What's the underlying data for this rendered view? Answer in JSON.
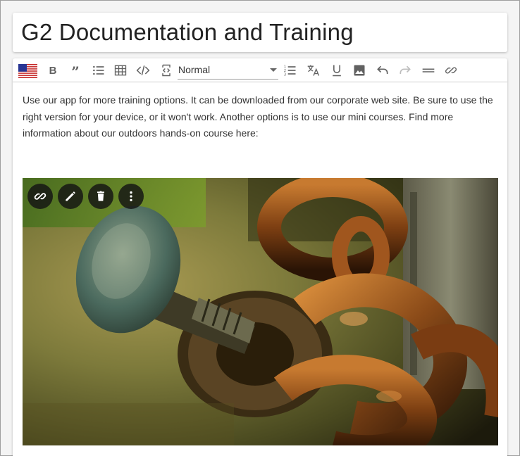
{
  "page": {
    "title": "G2 Documentation and Training"
  },
  "toolbar": {
    "language_icon": "us-flag-icon",
    "format_select": {
      "selected": "Normal"
    },
    "buttons": [
      {
        "name": "bold-button",
        "icon": "bold-icon"
      },
      {
        "name": "blockquote-button",
        "icon": "quote-icon"
      },
      {
        "name": "bulleted-list-button",
        "icon": "bulleted-list-icon"
      },
      {
        "name": "table-button",
        "icon": "table-icon"
      },
      {
        "name": "code-button",
        "icon": "code-icon"
      },
      {
        "name": "source-button",
        "icon": "source-icon"
      },
      {
        "name": "numbered-list-button",
        "icon": "numbered-list-icon"
      },
      {
        "name": "translate-button",
        "icon": "translate-icon"
      },
      {
        "name": "underline-button",
        "icon": "underline-icon"
      },
      {
        "name": "insert-image-button",
        "icon": "image-icon"
      },
      {
        "name": "undo-button",
        "icon": "undo-icon"
      },
      {
        "name": "redo-button",
        "icon": "redo-icon"
      },
      {
        "name": "horizontal-rule-button",
        "icon": "horizontal-rule-icon"
      },
      {
        "name": "link-button",
        "icon": "link-icon"
      }
    ]
  },
  "editor": {
    "paragraph": "Use our app for more training options. It can be downloaded from our corporate web site. Be sure to use the right version for your device, or it won't work. Another options is to use our mini courses. Find more information about our outdoors hands-on course here:"
  },
  "image_toolbar": {
    "buttons": [
      {
        "name": "image-link-button",
        "icon": "link-icon"
      },
      {
        "name": "image-edit-button",
        "icon": "pencil-icon"
      },
      {
        "name": "image-delete-button",
        "icon": "trash-icon"
      },
      {
        "name": "image-more-button",
        "icon": "more-vertical-icon"
      }
    ]
  },
  "colors": {
    "toolbar_icon": "#616161",
    "image_button_bg": "#141414",
    "title_text": "#222222"
  }
}
